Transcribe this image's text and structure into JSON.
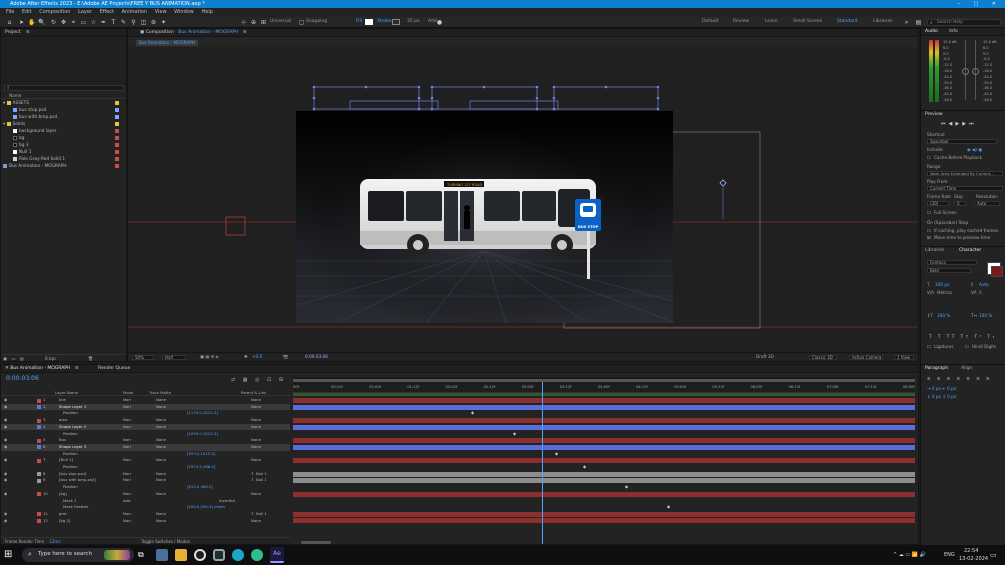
{
  "window": {
    "title": "Adobe After Effects 2023 - E:\\Adobe AE Projects\\FREE Y BUS ANIMATION.aep *",
    "controls": "– ▢ ✕"
  },
  "menu": [
    "File",
    "Edit",
    "Composition",
    "Layer",
    "Effect",
    "Animation",
    "View",
    "Window",
    "Help"
  ],
  "toolbar": {
    "universal": "Universal",
    "snapping": "Snapping",
    "fill": "Fill",
    "stroke": "Stroke",
    "stroke_px": "35 px",
    "add": "Add",
    "workspaces": [
      "Default",
      "Review",
      "Learn",
      "Small Screen",
      "Standard",
      "Libraries"
    ],
    "active_workspace": "Standard",
    "search_placeholder": "Search Help"
  },
  "project": {
    "header": "Project",
    "col_name": "Name",
    "items": [
      {
        "label": "ASSETS",
        "color": "#e8c33b"
      },
      {
        "label": "bus stop.psd",
        "color": "#7aa7ff"
      },
      {
        "label": "bus with bmp.psd",
        "color": "#7aa7ff"
      },
      {
        "label": "Solids",
        "color": "#e8c33b"
      },
      {
        "label": "background layer",
        "color": "#c94a4a"
      },
      {
        "label": "bg",
        "color": "#c94a4a"
      },
      {
        "label": "bg 3",
        "color": "#c94a4a"
      },
      {
        "label": "Null 1",
        "color": "#c94a4a"
      },
      {
        "label": "Pale Gray-Red Solid 1",
        "color": "#c94a4a"
      },
      {
        "label": "Bus Animation - MOGRAPH",
        "color": "#c94a4a"
      }
    ],
    "bpc": "8 bpc"
  },
  "composition": {
    "tab": "Composition",
    "tab_name": "Bus Animation - MOGRAPH",
    "breadcrumb": "Bus Animation - MOGRAPH",
    "view_label": "Active Camera (Default)",
    "zoom": "50%",
    "resolution": "Half",
    "timecode": "0:00:03:06",
    "exposure": "+0.0",
    "view_count": "1 View",
    "camera": "Active Camera",
    "renderer": "Classic 3D",
    "draft": "Draft 3D",
    "bus_sign": "BUS STOP",
    "bus_display": "TURNING 127 ROAD"
  },
  "timeline": {
    "tab": "Bus Animation - MOGRAPH",
    "render_queue": "Render Queue",
    "timecode": "0:00:03:06",
    "frame_render": "Frame Render Time",
    "frame_render_val": "12ms",
    "col_layer": "Layer Name",
    "col_mode": "Mode",
    "col_trkmat": "Track Matte",
    "col_parent": "Parent & Link",
    "ruler": [
      "00f",
      "00:12f",
      "01:00f",
      "01:12f",
      "02:00f",
      "02:12f",
      "03:00f",
      "03:12f",
      "04:00f",
      "04:12f",
      "05:00f",
      "05:12f",
      "06:00f",
      "06:12f",
      "07:00f",
      "07:12f",
      "08:00f"
    ],
    "playhead_fraction": 0.4,
    "rows": [
      {
        "num": "1",
        "name": "line",
        "mode": "Norr",
        "trk": "None",
        "parent": "None",
        "color": "#c94a4a",
        "bar": "#8b2f2f",
        "sel": false
      },
      {
        "num": "2",
        "name": "Shape Layer 1",
        "mode": "Norr",
        "trk": "None",
        "parent": "None",
        "color": "#5a77e0",
        "bar": "#5b6dd8",
        "sel": true
      },
      {
        "num": "",
        "name": "Position",
        "mode": "",
        "trk": "",
        "parent": "",
        "val": "[1170.0,1012.0]",
        "color": "",
        "bar": "",
        "sel": false
      },
      {
        "num": "3",
        "name": "area",
        "mode": "Norr",
        "trk": "None",
        "parent": "None",
        "color": "#c94a4a",
        "bar": "#8b2f2f",
        "sel": false
      },
      {
        "num": "4",
        "name": "Shape Layer 2",
        "mode": "Norr",
        "trk": "None",
        "parent": "None",
        "color": "#5a77e0",
        "bar": "#5b6dd8",
        "sel": true
      },
      {
        "num": "",
        "name": "Position",
        "mode": "",
        "trk": "",
        "parent": "",
        "val": "[1093.0,1012.0]",
        "color": "",
        "bar": "",
        "sel": false
      },
      {
        "num": "5",
        "name": "Bus",
        "mode": "Norr",
        "trk": "None",
        "parent": "None",
        "color": "#c94a4a",
        "bar": "#8b2f2f",
        "sel": false
      },
      {
        "num": "6",
        "name": "Shape Layer 3",
        "mode": "Norr",
        "trk": "None",
        "parent": "None",
        "color": "#5a77e0",
        "bar": "#5b6dd8",
        "sel": true
      },
      {
        "num": "",
        "name": "Position",
        "mode": "",
        "trk": "",
        "parent": "",
        "val": "[953.0,1012.0]",
        "color": "",
        "bar": "",
        "sel": false
      },
      {
        "num": "7",
        "name": "[Null 1]",
        "mode": "Norr",
        "trk": "None",
        "parent": "None",
        "color": "#c94a4a",
        "bar": "#8b2f2f",
        "sel": false
      },
      {
        "num": "",
        "name": "Position",
        "mode": "",
        "trk": "",
        "parent": "",
        "val": "[1974.5,468.0]",
        "color": "",
        "bar": "",
        "sel": false
      },
      {
        "num": "8",
        "name": "[bus stop.psd]",
        "mode": "Norr",
        "trk": "None",
        "parent": "7. Null 1",
        "color": "#9a9a9a",
        "bar": "#8d8d8d",
        "sel": false
      },
      {
        "num": "9",
        "name": "[bus with bmp.psd]",
        "mode": "Norr",
        "trk": "None",
        "parent": "7. Null 1",
        "color": "#9a9a9a",
        "bar": "#8d8d8d",
        "sel": false
      },
      {
        "num": "",
        "name": "Position",
        "mode": "",
        "trk": "",
        "parent": "",
        "val": "[613.0,466.0]",
        "color": "",
        "bar": "",
        "sel": false
      },
      {
        "num": "10",
        "name": "[bg]",
        "mode": "Norr",
        "trk": "None",
        "parent": "None",
        "color": "#c94a4a",
        "bar": "#8b2f2f",
        "sel": false
      },
      {
        "num": "",
        "name": "Mask 1",
        "mode": "Add",
        "trk": "Inverted",
        "parent": "",
        "val": "",
        "color": "",
        "bar": "",
        "sel": false
      },
      {
        "num": "",
        "name": "Mask Feather",
        "mode": "",
        "trk": "",
        "parent": "",
        "val": "[200.0,200.0] pixels",
        "color": "",
        "bar": "",
        "sel": false
      },
      {
        "num": "11",
        "name": "grid",
        "mode": "Norr",
        "trk": "None",
        "parent": "7. Null 1",
        "color": "#c94a4a",
        "bar": "#8b2f2f",
        "sel": false
      },
      {
        "num": "12",
        "name": "[bg 2]",
        "mode": "Norr",
        "trk": "None",
        "parent": "None",
        "color": "#c94a4a",
        "bar": "#8b2f2f",
        "sel": false
      }
    ],
    "toggle": "Toggle Switches / Modes"
  },
  "right_panel": {
    "audio": "Audio",
    "info": "Info",
    "db_labels": [
      "12.0 dB",
      "6.0",
      "0.0",
      "-6.0",
      "-12.0",
      "-18.0",
      "-24.0",
      "-30.0",
      "-36.0",
      "-42.0",
      "-48.0"
    ],
    "preview": "Preview",
    "shortcut": "Shortcut",
    "shortcut_val": "Spacebar",
    "include": "Include:",
    "cache_before": "Cache Before Playback",
    "range": "Range",
    "range_val": "Work Area Extended By Current...",
    "play_from": "Play From",
    "play_from_val": "Current Time",
    "frame_rate": "Frame Rate",
    "skip": "Skip",
    "resolution": "Resolution",
    "fr_val": "(30)",
    "skip_val": "0",
    "res_val": "Auto",
    "full_screen": "Full Screen",
    "on_stop": "On (Spacebar) Stop",
    "if_caching": "If caching, play cached frames",
    "move_time": "Move time to preview time",
    "libraries": "Libraries",
    "character": "Character",
    "font": "Fontoca",
    "style": "Bold",
    "size": "100 px",
    "leading": "Auto",
    "tracking": "0",
    "kerning": "Metrics",
    "paragraph": "Paragraph",
    "align": "Align",
    "ligatures": "Ligatures",
    "hindi": "Hindi Digits"
  },
  "taskbar": {
    "search": "Type here to search",
    "time": "22:54",
    "date": "13-02-2024",
    "lang": "ENG"
  }
}
